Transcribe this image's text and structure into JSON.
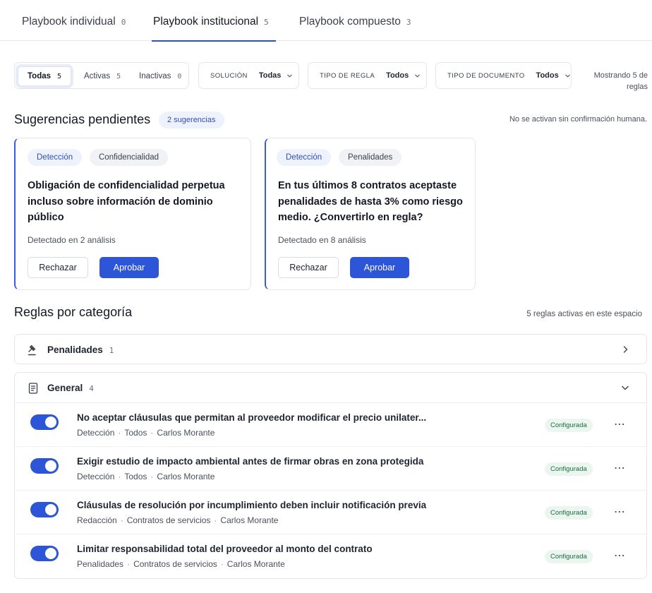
{
  "tabs": [
    {
      "label": "Playbook individual",
      "count": "0"
    },
    {
      "label": "Playbook institucional",
      "count": "5"
    },
    {
      "label": "Playbook compuesto",
      "count": "3"
    }
  ],
  "active_tab": "Playbook institucional",
  "filters": {
    "status": [
      {
        "label": "Todas",
        "count": "5"
      },
      {
        "label": "Activas",
        "count": "5"
      },
      {
        "label": "Inactivas",
        "count": "0"
      }
    ],
    "solution": {
      "label": "SOLUCIÓN",
      "value": "Todas"
    },
    "rule_type": {
      "label": "TIPO DE REGLA",
      "value": "Todos"
    },
    "doc_type": {
      "label": "TIPO DE DOCUMENTO",
      "value": "Todos"
    },
    "showing": "Mostrando 5 de reglas"
  },
  "suggestions": {
    "title": "Sugerencias pendientes",
    "badge": "2 sugerencias",
    "note": "No se activan sin confirmación humana.",
    "cards": [
      {
        "tags": [
          "Detección",
          "Confidencialidad"
        ],
        "text": "Obligación de confidencialidad perpetua incluso sobre información de dominio público",
        "meta": "Detectado en 2 análisis",
        "reject": "Rechazar",
        "approve": "Aprobar"
      },
      {
        "tags": [
          "Detección",
          "Penalidades"
        ],
        "text": "En tus últimos 8 contratos aceptaste penalidades de hasta 3% como riesgo medio. ¿Convertirlo en regla?",
        "meta": "Detectado en 8 análisis",
        "reject": "Rechazar",
        "approve": "Aprobar"
      }
    ]
  },
  "rules": {
    "title": "Reglas por categoría",
    "note": "5 reglas activas en este espacio",
    "categories": [
      {
        "name": "Penalidades",
        "count": "1",
        "icon": "gavel-icon",
        "expanded": false
      },
      {
        "name": "General",
        "count": "4",
        "icon": "document-icon",
        "expanded": true
      }
    ],
    "items": [
      {
        "title": "No aceptar cláusulas que permitan al proveedor modificar el precio unilater...",
        "meta": [
          "Detección",
          "Todos",
          "Carlos Morante"
        ],
        "status": "Configurada",
        "enabled": true
      },
      {
        "title": "Exigir estudio de impacto ambiental antes de firmar obras en zona protegida",
        "meta": [
          "Detección",
          "Todos",
          "Carlos Morante"
        ],
        "status": "Configurada",
        "enabled": true
      },
      {
        "title": "Cláusulas de resolución por incumplimiento deben incluir notificación previa",
        "meta": [
          "Redacción",
          "Contratos de servicios",
          "Carlos Morante"
        ],
        "status": "Configurada",
        "enabled": true
      },
      {
        "title": "Limitar responsabilidad total del proveedor al monto del contrato",
        "meta": [
          "Penalidades",
          "Contratos de servicios",
          "Carlos Morante"
        ],
        "status": "Configurada",
        "enabled": true
      }
    ]
  },
  "colors": {
    "accent": "#2c55d8",
    "badge_green_bg": "#eaf6ef",
    "badge_green_text": "#1e6b3e",
    "chip_blue_bg": "#eef2fd"
  }
}
